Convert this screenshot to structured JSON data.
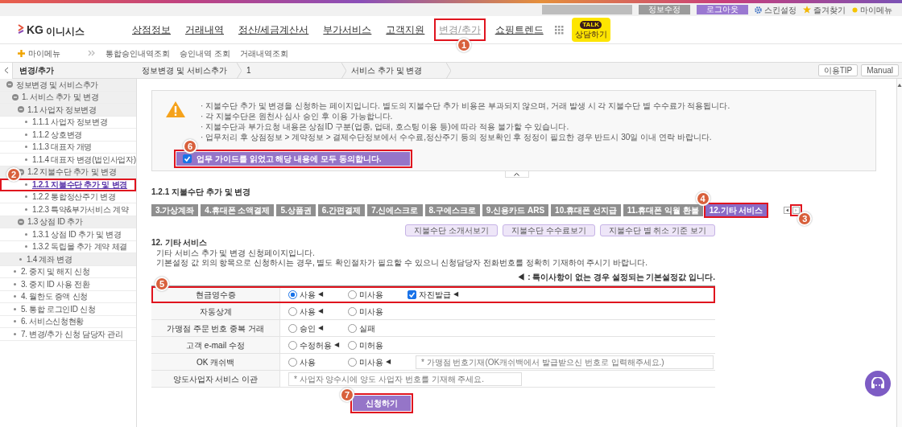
{
  "utility": {
    "links": [
      {
        "kind": "dark",
        "label": "정보수정"
      },
      {
        "kind": "purple",
        "label": "로그아웃"
      },
      {
        "kind": "skin",
        "label": "스킨설정"
      },
      {
        "kind": "favorite",
        "label": "즐겨찾기"
      },
      {
        "kind": "mymenu",
        "label": "마이메뉴"
      }
    ]
  },
  "logo": {
    "mark": "KG",
    "text": "이니시스"
  },
  "nav": {
    "items": [
      {
        "label": "상점정보",
        "selected": false
      },
      {
        "label": "거래내역",
        "selected": false
      },
      {
        "label": "정산/세금계산서",
        "selected": false
      },
      {
        "label": "부가서비스",
        "selected": false
      },
      {
        "label": "고객지원",
        "selected": false
      },
      {
        "label": "변경/추가",
        "selected": true,
        "callout": "1"
      },
      {
        "label": "쇼핑트렌드",
        "selected": false
      }
    ],
    "talk": {
      "label": "TALK",
      "caption": "상담하기"
    }
  },
  "submenu": {
    "mymenu": "마이메뉴",
    "links": [
      "통합승인내역조회",
      "승인내역 조회",
      "거래내역조회"
    ]
  },
  "breadcrumb": {
    "title": "변경/추가",
    "steps": [
      "정보변경 및 서비스추가",
      "1",
      "서비스 추가 및 변경"
    ],
    "buttons": [
      "이용TIP",
      "Manual"
    ]
  },
  "sidebar": {
    "items": [
      {
        "label": "정보변경 및 서비스추가",
        "selected": false,
        "children": [
          {
            "label": "1. 서비스 추가 및 변경",
            "selected": false,
            "children": [
              {
                "label": "1.1 사업자 정보변경",
                "selected": false,
                "children": [
                  {
                    "label": "1.1.1 사업자 정보변경",
                    "selected": false
                  },
                  {
                    "label": "1.1.2 상호변경",
                    "selected": false
                  },
                  {
                    "label": "1.1.3 대표자 개명",
                    "selected": false
                  },
                  {
                    "label": "1.1.4 대표자 변경(법인사업자)",
                    "selected": false
                  }
                ]
              },
              {
                "label": "1.2 지불수단 추가 및 변경",
                "selected": false,
                "children": [
                  {
                    "label": "1.2.1 지불수단 추가 및 변경",
                    "selected": true,
                    "callout": "2"
                  },
                  {
                    "label": "1.2.2 통합정산주기 변경",
                    "selected": false
                  },
                  {
                    "label": "1.2.3 특약&부가서비스 계약",
                    "selected": false
                  }
                ]
              },
              {
                "label": "1.3 상점 ID 추가",
                "selected": false,
                "children": [
                  {
                    "label": "1.3.1 상점 ID 추가 및 변경",
                    "selected": false
                  },
                  {
                    "label": "1.3.2 독립몰 추가 계약 체결",
                    "selected": false
                  }
                ]
              },
              {
                "label": "1.4 계좌 변경",
                "selected": false
              }
            ]
          },
          {
            "label": "2. 중지 및 해지 신청",
            "selected": false
          },
          {
            "label": "3. 중지 ID 사용 전환",
            "selected": false
          },
          {
            "label": "4. 월한도 증액 신청",
            "selected": false
          },
          {
            "label": "5. 통합 로그인ID 신청",
            "selected": false
          },
          {
            "label": "6. 서비스신청현황",
            "selected": false
          },
          {
            "label": "7. 변경/추가 신청 담당자 관리",
            "selected": false
          }
        ]
      }
    ]
  },
  "notice": {
    "lines": [
      "· 지불수단 추가 및 변경을 신청하는 페이지입니다. 별도의 지불수단 추가 비용은 부과되지 않으며, 거래 발생 시 각 지불수단 별 수수료가 적용됩니다.",
      "· 각 지불수단은 원천사 심사 승인 후 이용 가능합니다.",
      "· 지불수단과 부가요청 내용은 상점ID 구분(업종, 업태, 호스팅 이용 등)에 따라 적용 불가할 수 있습니다.",
      "· 업무처리 후 상점정보 > 계약정보 > 결제수단정보에서 수수료,정산주기 등의 정보확인 후 정정이 필요한 경우 반드시 30일 이내 연락 바랍니다."
    ],
    "agree": {
      "label": "업무 가이드를 읽었고 해당 내용에 모두 동의합니다.",
      "checked": true,
      "callout": "6"
    }
  },
  "section_title": "1.2.1 지불수단 추가 및 변경",
  "payment_tabs": [
    {
      "label": "3.가상계좌",
      "selected": false
    },
    {
      "label": "4.휴대폰 소액결제",
      "selected": false
    },
    {
      "label": "5.상품권",
      "selected": false
    },
    {
      "label": "6.간편결제",
      "selected": false
    },
    {
      "label": "7.신에스크로",
      "selected": false
    },
    {
      "label": "8.구에스크로",
      "selected": false
    },
    {
      "label": "9.신용카드 ARS",
      "selected": false
    },
    {
      "label": "10.휴대폰 선지급",
      "selected": false
    },
    {
      "label": "11.휴대폰 익월 환불",
      "selected": false
    },
    {
      "label": "12.기타 서비스",
      "selected": true,
      "callout": "4"
    }
  ],
  "tab_pager": [
    {
      "kind": "prev"
    },
    {
      "kind": "next",
      "callout": "3"
    }
  ],
  "guide_buttons": [
    "지불수단 소개서보기",
    "지불수단 수수료보기",
    "지불수단 별 취소 기준 보기"
  ],
  "service": {
    "heading": "12. 기타 서비스",
    "description": [
      "기타 서비스 추가 및 변경 신청페이지입니다.",
      "기본설정 값 외의 항목으로 신청하시는 경우, 별도 확인절차가 필요할 수 있으니 신청담당자 전화번호를 정확히 기재하여 주시기 바랍니다."
    ],
    "legend": "◀ : 특이사항이 없는 경우 설정되는 기본설정값 입니다."
  },
  "form_rows": [
    {
      "label": "현금영수증",
      "callout": "5",
      "options": [
        {
          "kind": "radio",
          "label": "사용",
          "selected": true,
          "marker": "◀"
        },
        {
          "kind": "radio",
          "label": "미사용",
          "selected": false
        },
        {
          "kind": "checkbox",
          "label": "자진발급",
          "checked": true,
          "marker": "◀"
        }
      ]
    },
    {
      "label": "자동상계",
      "options": [
        {
          "kind": "radio",
          "label": "사용",
          "selected": false,
          "marker": "◀"
        },
        {
          "kind": "radio",
          "label": "미사용",
          "selected": false
        }
      ]
    },
    {
      "label": "가맹점 주문 번호 중복 거래",
      "options": [
        {
          "kind": "radio",
          "label": "승인",
          "selected": false,
          "marker": "◀"
        },
        {
          "kind": "radio",
          "label": "실패",
          "selected": false
        }
      ]
    },
    {
      "label": "고객 e-mail 수정",
      "options": [
        {
          "kind": "radio",
          "label": "수정허용",
          "selected": false,
          "marker": "◀"
        },
        {
          "kind": "radio",
          "label": "미허용",
          "selected": false
        }
      ]
    },
    {
      "label": "OK 캐쉬백",
      "options": [
        {
          "kind": "radio",
          "label": "사용",
          "selected": false
        },
        {
          "kind": "radio",
          "label": "미사용",
          "selected": false,
          "marker": "◀"
        }
      ],
      "placeholder": "* 가맹점 번호기재(OK캐쉬백에서 발급받으신 번호로 입력해주세요.)"
    },
    {
      "label": "양도사업자 서비스 이관",
      "placeholder": "* 사업자 양수시에 양도 사업자 번호를 기재해 주세요."
    }
  ],
  "submit": {
    "label": "신청하기",
    "callout": "7"
  }
}
